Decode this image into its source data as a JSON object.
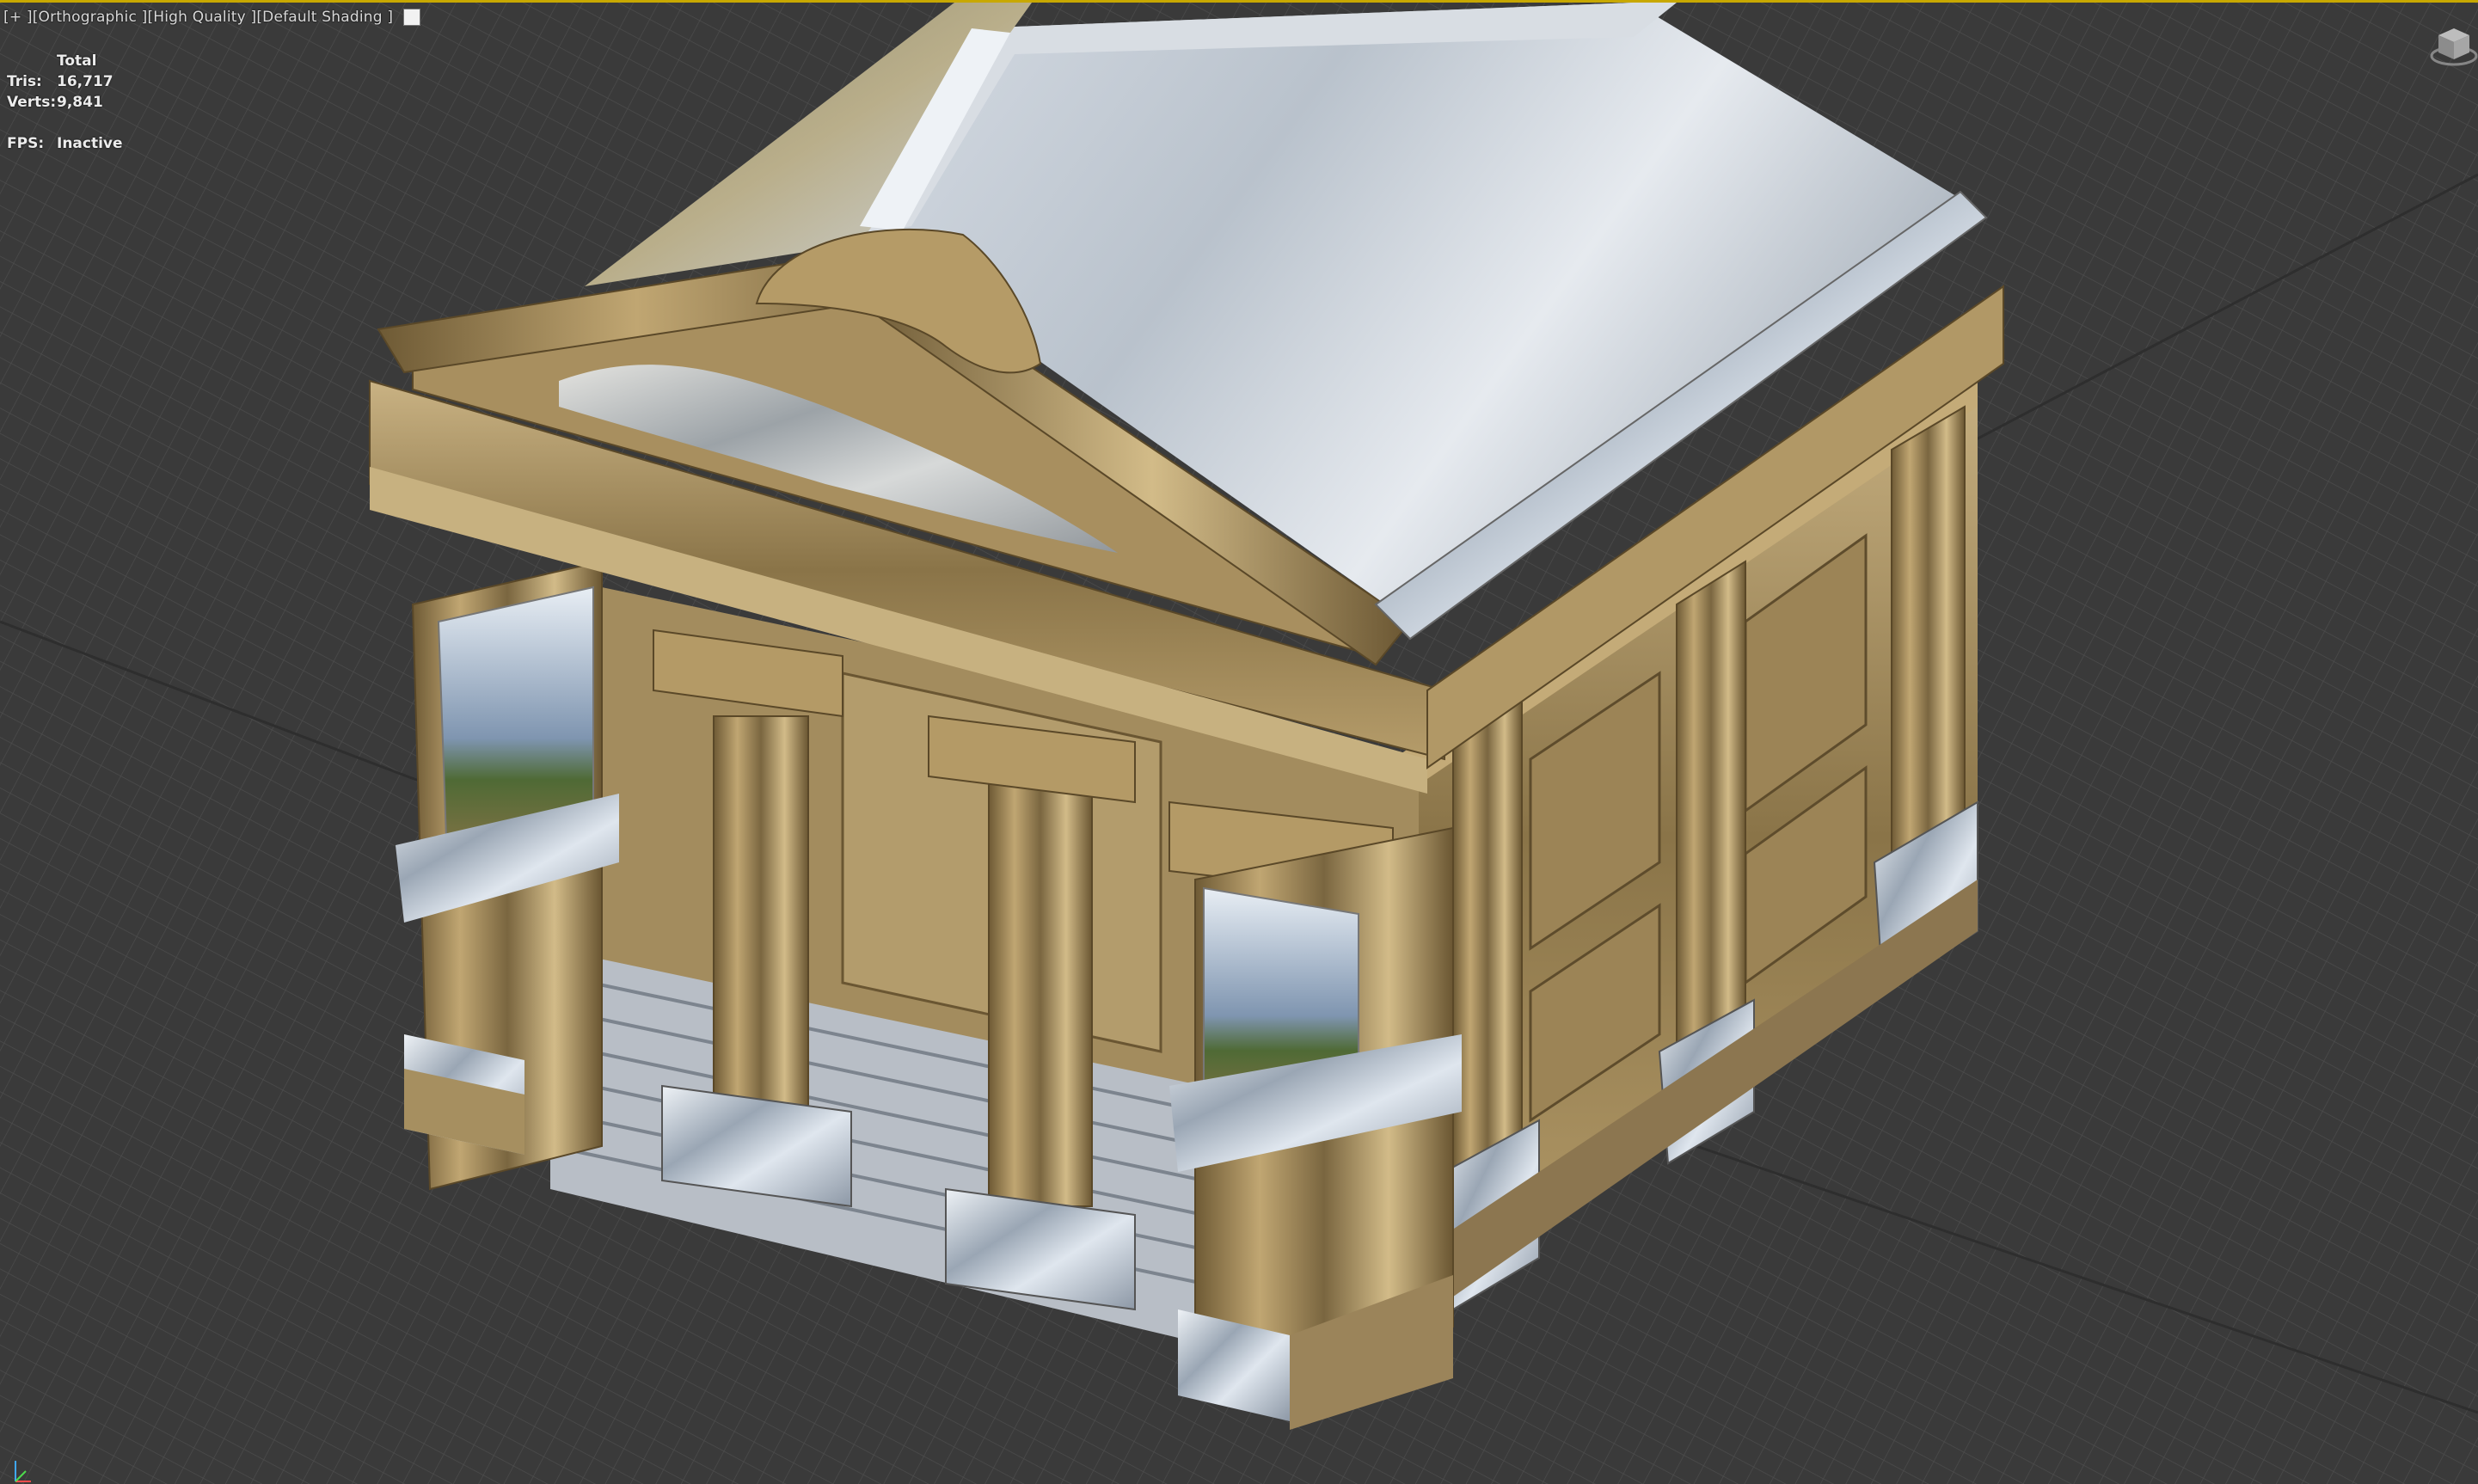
{
  "viewport": {
    "label": {
      "plus_menu": "[+ ]",
      "point_of_view": "[Orthographic ]",
      "quality": "[High Quality ]",
      "shading": "[Default Shading ]"
    },
    "stats": {
      "header": "Total",
      "tris_label": "Tris:",
      "tris_value": "16,717",
      "verts_label": "Verts:",
      "verts_value": "9,841",
      "fps_label": "FPS:",
      "fps_value": "Inactive"
    },
    "icons": {
      "viewcube": "viewcube-icon",
      "axis_tripod": "axis-tripod-icon",
      "shading_swatch": "shading-swatch-icon"
    },
    "colors": {
      "active_viewport_border": "#c8a800",
      "background": "#3a3a3a",
      "grid": "#4a4a4a",
      "gold": "#a88d58",
      "chrome": "#c8d0d8"
    }
  }
}
